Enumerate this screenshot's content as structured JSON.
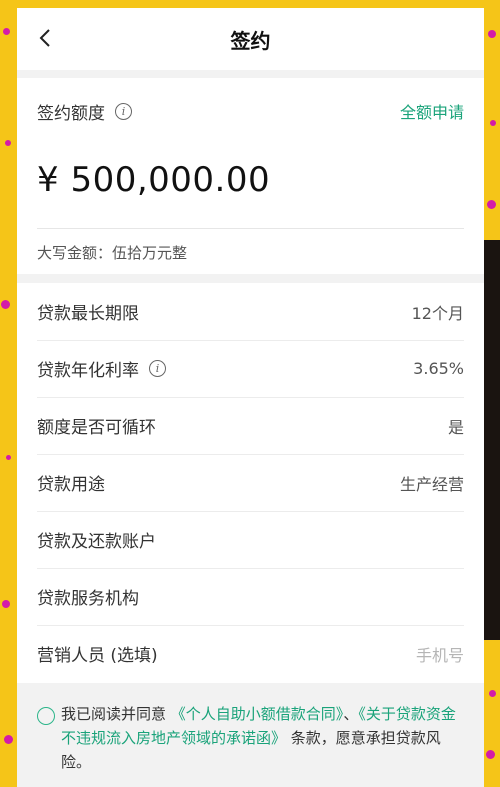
{
  "header": {
    "title": "签约"
  },
  "amount": {
    "label": "签约额度",
    "full_apply": "全额申请",
    "value": "¥ 500,000.00",
    "capital": "大写金额：伍拾万元整"
  },
  "details": {
    "rows": [
      {
        "label": "贷款最长期限",
        "value": "12个月"
      },
      {
        "label": "贷款年化利率",
        "value": "3.65%"
      },
      {
        "label": "额度是否可循环",
        "value": "是"
      },
      {
        "label": "贷款用途",
        "value": "生产经营"
      },
      {
        "label": "贷款及还款账户",
        "value": ""
      },
      {
        "label": "贷款服务机构",
        "value": ""
      },
      {
        "label": "营销人员 (选填)",
        "placeholder": "手机号"
      }
    ]
  },
  "agreement": {
    "prefix": "我已阅读并同意",
    "contract_link": "《个人自助小额借款合同》",
    "separator": "、",
    "promise_link": "《关于贷款资金不违规流入房地产领域的承诺函》",
    "suffix": "条款，愿意承担贷款风险。"
  },
  "colors": {
    "accent": "#1aa37a",
    "frame": "#f5c518",
    "dots": "#d41ba8"
  }
}
